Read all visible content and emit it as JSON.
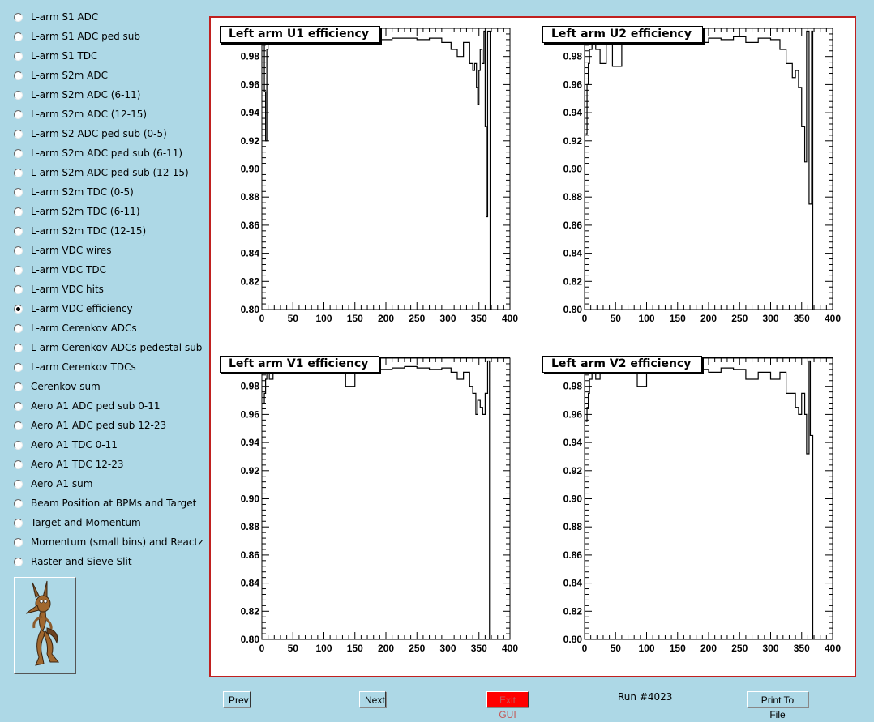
{
  "sidebar": {
    "items": [
      {
        "label": "L-arm S1 ADC",
        "checked": false
      },
      {
        "label": "L-arm S1 ADC ped sub",
        "checked": false
      },
      {
        "label": "L-arm S1 TDC",
        "checked": false
      },
      {
        "label": "L-arm S2m ADC",
        "checked": false
      },
      {
        "label": "L-arm S2m ADC (6-11)",
        "checked": false
      },
      {
        "label": "L-arm S2m ADC (12-15)",
        "checked": false
      },
      {
        "label": "L-arm S2 ADC ped sub (0-5)",
        "checked": false
      },
      {
        "label": "L-arm S2m ADC ped sub (6-11)",
        "checked": false
      },
      {
        "label": "L-arm S2m ADC ped sub (12-15)",
        "checked": false
      },
      {
        "label": "L-arm S2m TDC (0-5)",
        "checked": false
      },
      {
        "label": "L-arm S2m TDC (6-11)",
        "checked": false
      },
      {
        "label": "L-arm S2m TDC (12-15)",
        "checked": false
      },
      {
        "label": "L-arm VDC wires",
        "checked": false
      },
      {
        "label": "L-arm VDC TDC",
        "checked": false
      },
      {
        "label": "L-arm VDC hits",
        "checked": false
      },
      {
        "label": "L-arm VDC efficiency",
        "checked": true
      },
      {
        "label": "L-arm Cerenkov ADCs",
        "checked": false
      },
      {
        "label": "L-arm Cerenkov ADCs pedestal sub",
        "checked": false
      },
      {
        "label": "L-arm Cerenkov TDCs",
        "checked": false
      },
      {
        "label": "Cerenkov sum",
        "checked": false
      },
      {
        "label": "Aero A1 ADC ped sub 0-11",
        "checked": false
      },
      {
        "label": "Aero A1 ADC ped sub 12-23",
        "checked": false
      },
      {
        "label": "Aero A1 TDC 0-11",
        "checked": false
      },
      {
        "label": "Aero A1 TDC 12-23",
        "checked": false
      },
      {
        "label": "Aero A1 sum",
        "checked": false
      },
      {
        "label": "Beam Position at BPMs and Target",
        "checked": false
      },
      {
        "label": "Target and Momentum",
        "checked": false
      },
      {
        "label": "Momentum (small bins) and Reactz",
        "checked": false
      },
      {
        "label": "Raster and Sieve Slit",
        "checked": false
      }
    ],
    "logo_icon": "coyote-logo-icon"
  },
  "footer": {
    "prev_label": "Prev",
    "next_label": "Next",
    "exit_label": "Exit GUI",
    "run_label": "Run #4023",
    "print_label": "Print To File",
    "exit_color": "#ff0000"
  },
  "colors": {
    "background": "#add8e6",
    "canvas_border": "#c0201f",
    "line": "#000000"
  },
  "chart_data": [
    {
      "type": "line",
      "title": "Left arm U1 efficiency",
      "xlim": [
        0,
        400
      ],
      "ylim": [
        0.8,
        1.0
      ],
      "xticks": [
        0,
        50,
        100,
        150,
        200,
        250,
        300,
        350,
        400
      ],
      "yticks": [
        0.8,
        0.82,
        0.84,
        0.86,
        0.88,
        0.9,
        0.92,
        0.94,
        0.96,
        0.98
      ],
      "x": [
        2,
        4,
        6,
        8,
        10,
        15,
        25,
        40,
        55,
        70,
        90,
        110,
        130,
        150,
        170,
        190,
        210,
        230,
        250,
        270,
        290,
        305,
        315,
        325,
        335,
        340,
        343,
        346,
        348,
        350,
        352,
        355,
        358,
        360,
        362,
        364,
        366,
        368
      ],
      "y": [
        0.99,
        0.955,
        0.92,
        0.985,
        0.99,
        0.993,
        0.992,
        0.993,
        0.992,
        0.994,
        0.993,
        0.992,
        0.993,
        0.994,
        0.993,
        0.992,
        0.993,
        0.993,
        0.992,
        0.993,
        0.99,
        0.985,
        0.98,
        0.99,
        0.975,
        0.97,
        0.975,
        0.958,
        0.946,
        0.97,
        0.985,
        0.975,
        0.998,
        0.93,
        0.866,
        0.998,
        0.998,
        0.8
      ]
    },
    {
      "type": "line",
      "title": "Left arm U2 efficiency",
      "xlim": [
        0,
        400
      ],
      "ylim": [
        0.8,
        1.0
      ],
      "xticks": [
        0,
        50,
        100,
        150,
        200,
        250,
        300,
        350,
        400
      ],
      "yticks": [
        0.8,
        0.82,
        0.84,
        0.86,
        0.88,
        0.9,
        0.92,
        0.94,
        0.96,
        0.98
      ],
      "x": [
        2,
        4,
        6,
        8,
        12,
        18,
        25,
        35,
        45,
        60,
        80,
        100,
        120,
        140,
        160,
        180,
        200,
        220,
        240,
        260,
        280,
        300,
        315,
        325,
        335,
        340,
        345,
        350,
        355,
        358,
        362,
        366,
        368
      ],
      "y": [
        0.925,
        0.96,
        0.975,
        0.985,
        0.99,
        0.985,
        0.975,
        0.99,
        0.973,
        0.992,
        0.993,
        0.992,
        0.993,
        0.994,
        0.993,
        0.99,
        0.993,
        0.992,
        0.994,
        0.99,
        0.993,
        0.992,
        0.985,
        0.975,
        0.965,
        0.97,
        0.958,
        0.93,
        0.905,
        0.998,
        0.875,
        0.998,
        0.8
      ]
    },
    {
      "type": "line",
      "title": "Left arm V1 efficiency",
      "xlim": [
        0,
        400
      ],
      "ylim": [
        0.8,
        1.0
      ],
      "xticks": [
        0,
        50,
        100,
        150,
        200,
        250,
        300,
        350,
        400
      ],
      "yticks": [
        0.8,
        0.82,
        0.84,
        0.86,
        0.88,
        0.9,
        0.92,
        0.94,
        0.96,
        0.98
      ],
      "x": [
        2,
        4,
        6,
        8,
        12,
        18,
        25,
        40,
        60,
        80,
        100,
        120,
        135,
        150,
        170,
        190,
        210,
        230,
        250,
        270,
        290,
        305,
        315,
        325,
        335,
        340,
        345,
        348,
        352,
        356,
        360,
        364,
        367
      ],
      "y": [
        0.968,
        0.975,
        0.985,
        0.99,
        0.985,
        0.99,
        0.992,
        0.993,
        0.992,
        0.99,
        0.993,
        0.992,
        0.98,
        0.993,
        0.994,
        0.992,
        0.993,
        0.994,
        0.993,
        0.992,
        0.993,
        0.99,
        0.985,
        0.99,
        0.98,
        0.975,
        0.96,
        0.97,
        0.965,
        0.96,
        0.975,
        0.998,
        0.8
      ]
    },
    {
      "type": "line",
      "title": "Left arm V2 efficiency",
      "xlim": [
        0,
        400
      ],
      "ylim": [
        0.8,
        1.0
      ],
      "xticks": [
        0,
        50,
        100,
        150,
        200,
        250,
        300,
        350,
        400
      ],
      "yticks": [
        0.8,
        0.82,
        0.84,
        0.86,
        0.88,
        0.9,
        0.92,
        0.94,
        0.96,
        0.98
      ],
      "x": [
        2,
        4,
        6,
        8,
        12,
        18,
        25,
        35,
        50,
        70,
        85,
        100,
        120,
        140,
        160,
        180,
        200,
        220,
        240,
        260,
        280,
        300,
        315,
        325,
        335,
        340,
        345,
        350,
        355,
        358,
        362,
        364,
        368
      ],
      "y": [
        0.955,
        0.965,
        0.975,
        0.985,
        0.99,
        0.985,
        0.99,
        0.992,
        0.99,
        0.993,
        0.98,
        0.992,
        0.993,
        0.99,
        0.993,
        0.992,
        0.99,
        0.993,
        0.992,
        0.985,
        0.99,
        0.985,
        0.99,
        0.975,
        0.975,
        0.965,
        0.96,
        0.975,
        0.96,
        0.932,
        0.998,
        0.945,
        0.8
      ]
    }
  ]
}
